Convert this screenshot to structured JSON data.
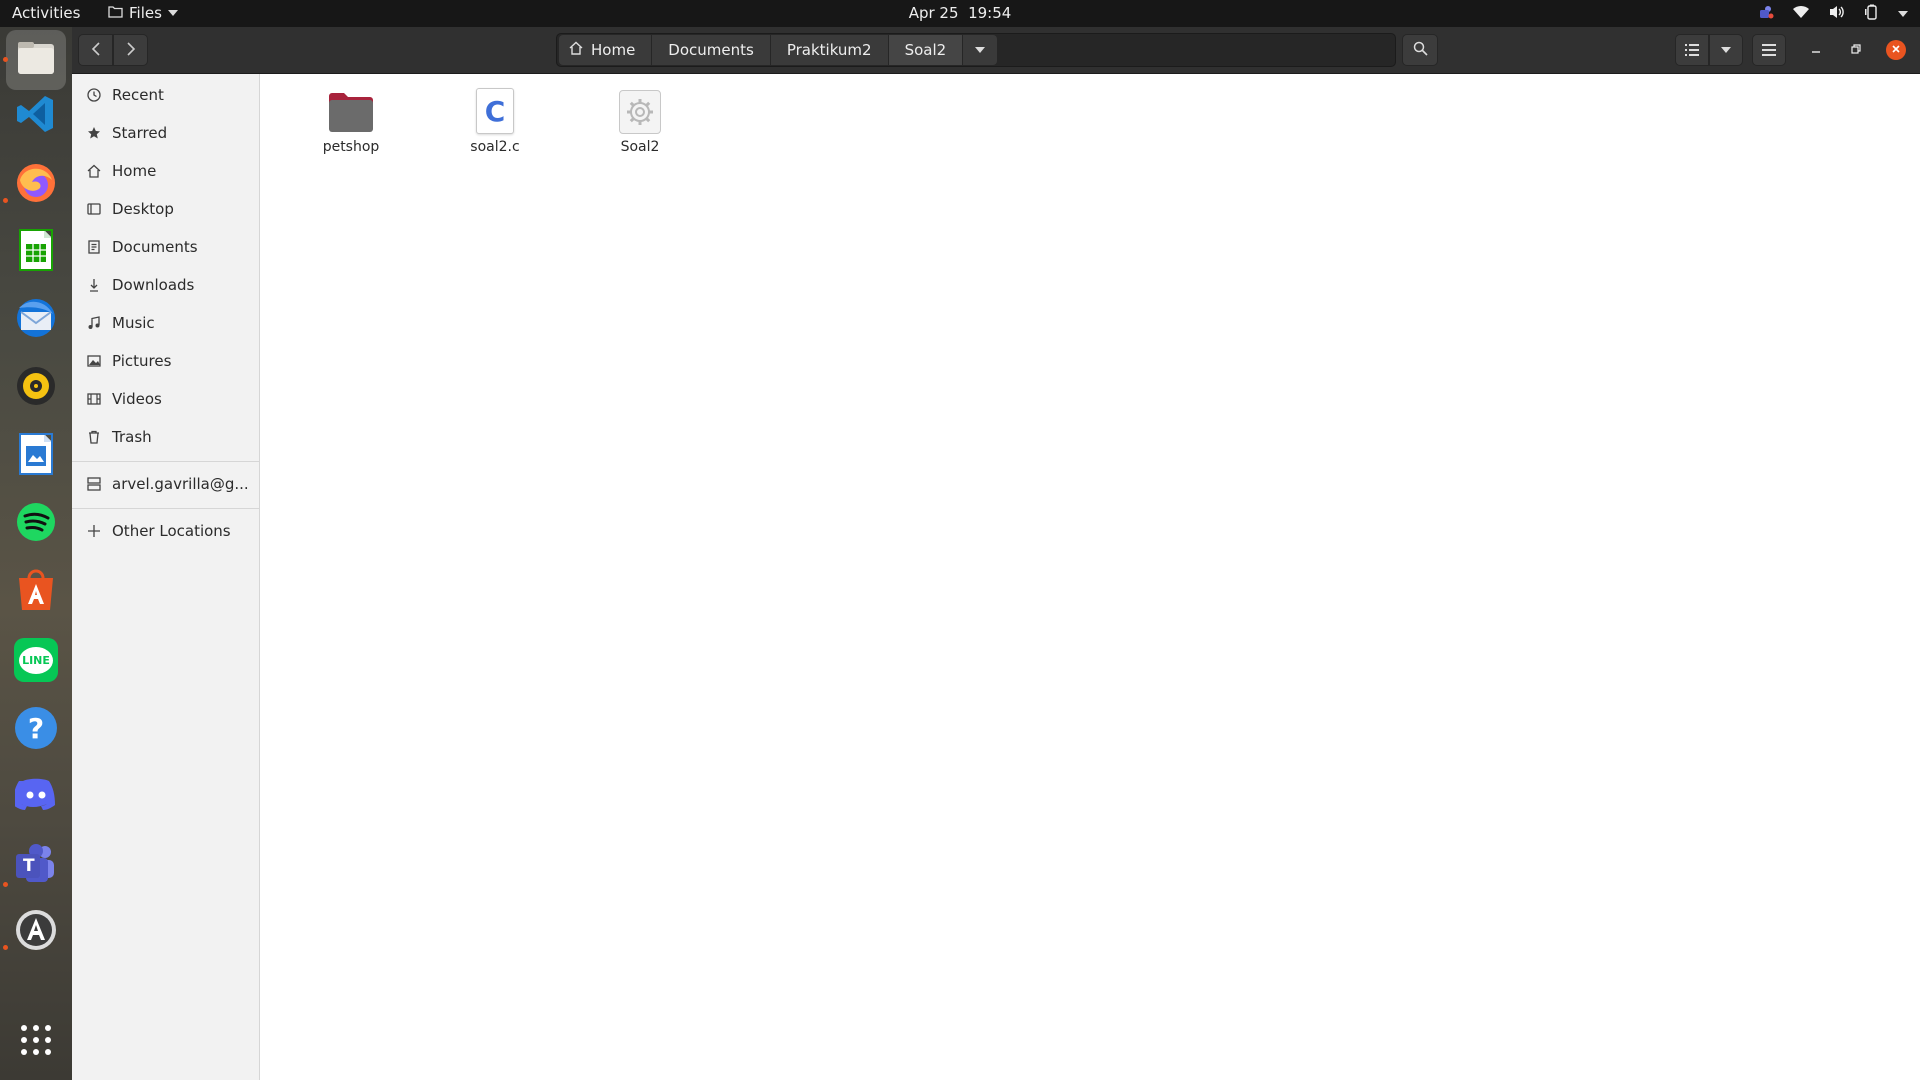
{
  "topbar": {
    "activities": "Activities",
    "app_menu": "Files",
    "date": "Apr 25",
    "time": "19:54"
  },
  "dock": {
    "apps": [
      {
        "name": "files",
        "icon": "files-icon",
        "running": true,
        "active": true
      },
      {
        "name": "vscode",
        "icon": "vscode-icon",
        "running": false
      },
      {
        "name": "firefox",
        "icon": "firefox-icon",
        "running": true
      },
      {
        "name": "calc",
        "icon": "spreadsheet-icon",
        "running": false
      },
      {
        "name": "thunderbird",
        "icon": "mail-icon",
        "running": false
      },
      {
        "name": "rhythmbox",
        "icon": "music-player-icon",
        "running": false
      },
      {
        "name": "writer",
        "icon": "document-icon",
        "running": false
      },
      {
        "name": "spotify",
        "icon": "spotify-icon",
        "running": false
      },
      {
        "name": "software",
        "icon": "app-store-icon",
        "running": false
      },
      {
        "name": "line",
        "icon": "line-icon",
        "label": "LINE",
        "running": false
      },
      {
        "name": "help",
        "icon": "help-icon",
        "label": "?",
        "running": false
      },
      {
        "name": "discord",
        "icon": "discord-icon",
        "running": false
      },
      {
        "name": "teams",
        "icon": "teams-icon",
        "label": "T",
        "running": true
      },
      {
        "name": "updater",
        "icon": "software-updater-icon",
        "running": true
      }
    ]
  },
  "pathbar": {
    "crumbs": [
      "Home",
      "Documents",
      "Praktikum2",
      "Soal2"
    ]
  },
  "sidebar": {
    "places": [
      {
        "label": "Recent",
        "icon": "clock-icon"
      },
      {
        "label": "Starred",
        "icon": "star-icon"
      },
      {
        "label": "Home",
        "icon": "home-icon"
      },
      {
        "label": "Desktop",
        "icon": "desktop-icon"
      },
      {
        "label": "Documents",
        "icon": "documents-icon"
      },
      {
        "label": "Downloads",
        "icon": "download-icon"
      },
      {
        "label": "Music",
        "icon": "music-icon"
      },
      {
        "label": "Pictures",
        "icon": "picture-icon"
      },
      {
        "label": "Videos",
        "icon": "video-icon"
      },
      {
        "label": "Trash",
        "icon": "trash-icon"
      }
    ],
    "network": {
      "label": "arvel.gavrilla@g...",
      "icon": "network-drive-icon"
    },
    "other": {
      "label": "Other Locations",
      "icon": "plus-icon"
    }
  },
  "files": [
    {
      "name": "petshop",
      "type": "folder",
      "icon": "folder-icon"
    },
    {
      "name": "soal2.c",
      "type": "c-source",
      "icon": "c-source-file-icon",
      "glyph": "C"
    },
    {
      "name": "Soal2",
      "type": "executable",
      "icon": "executable-file-icon"
    }
  ],
  "colors": {
    "accent": "#e95420",
    "headerbar": "#303030",
    "sidebar": "#f2f2f2",
    "folder": "#6b6b6b",
    "folder_tab": "#a8233c"
  }
}
